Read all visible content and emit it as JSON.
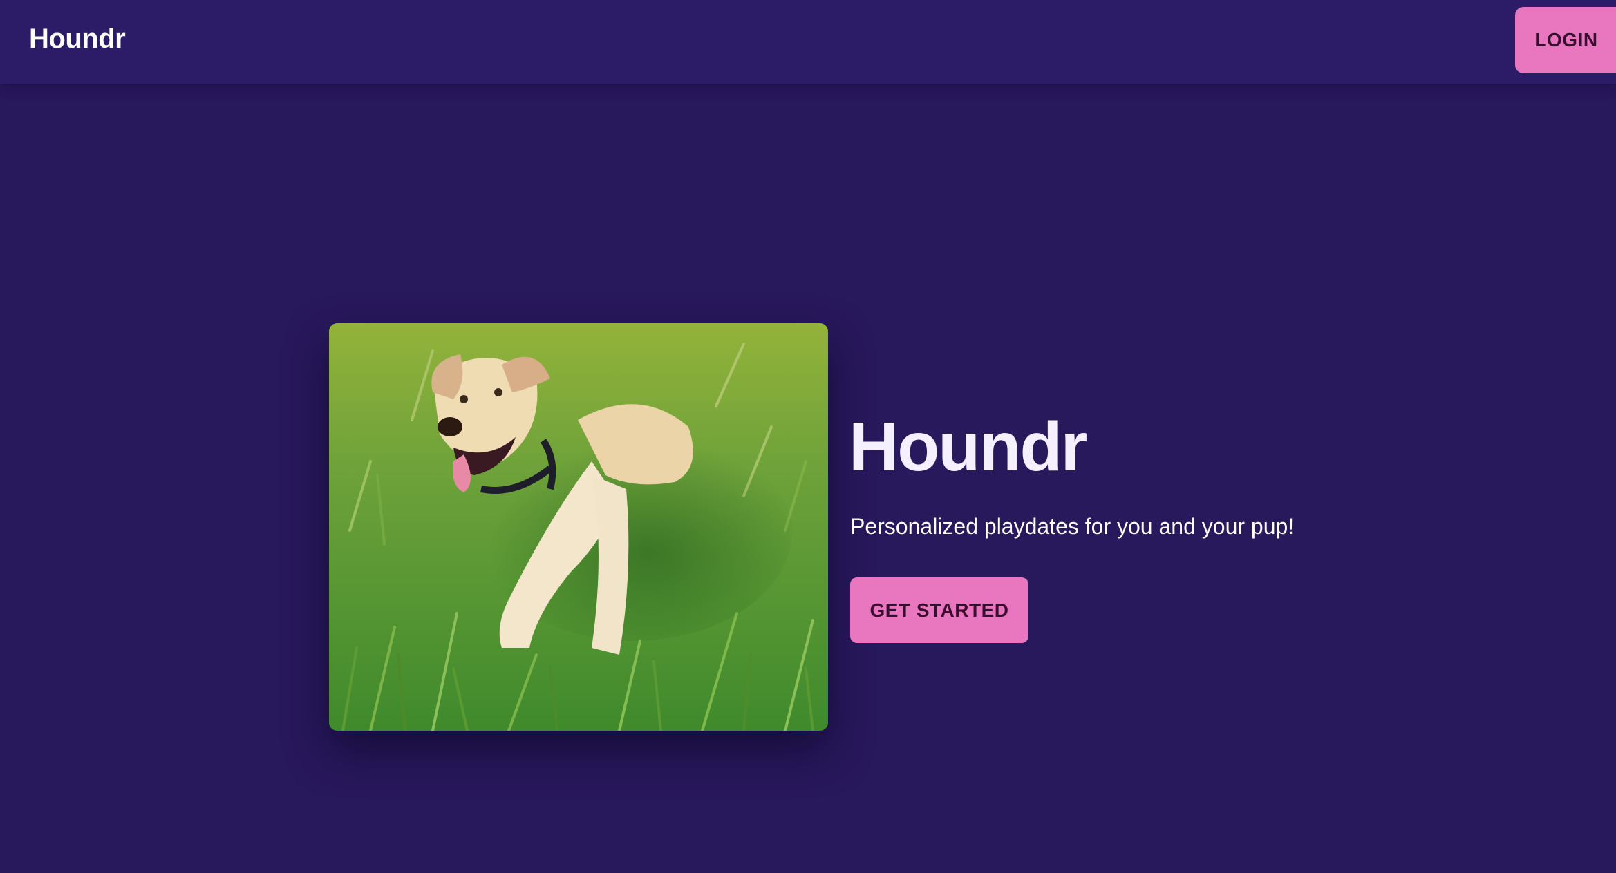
{
  "header": {
    "brand": "Houndr",
    "login_label": "LOGIN"
  },
  "hero": {
    "title": "Houndr",
    "subtitle": "Personalized playdates for you and your pup!",
    "cta_label": "GET STARTED",
    "image_subject": "dog-in-grass-photo"
  },
  "colors": {
    "background": "#28185c",
    "navbar": "#2c1c68",
    "accent": "#e877c0",
    "button_text": "#3a0d2e",
    "title_text": "#f4f0ff"
  }
}
